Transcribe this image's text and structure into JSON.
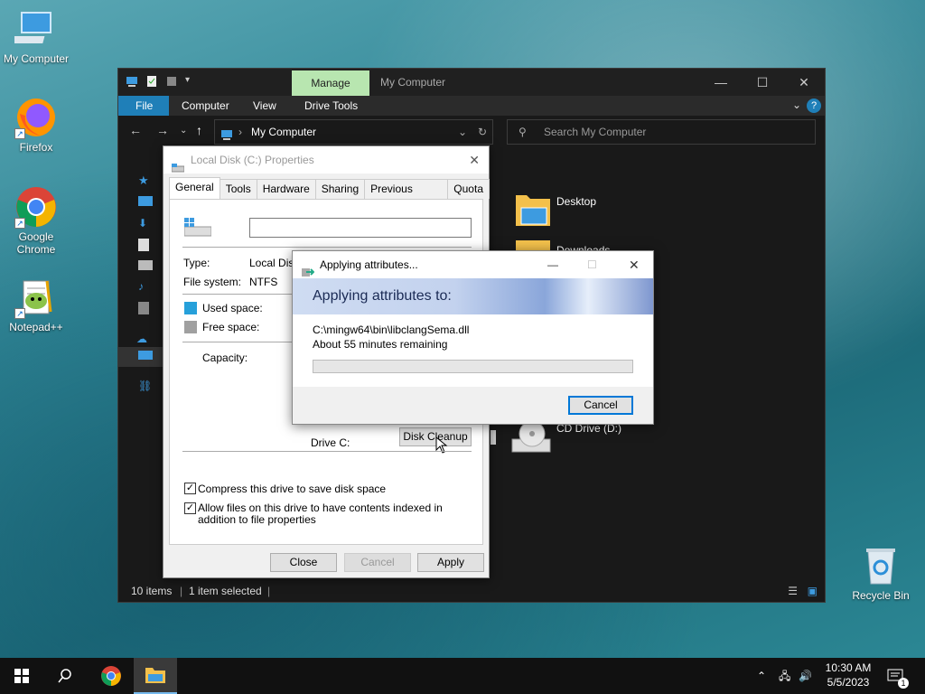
{
  "desktop": {
    "icons": [
      {
        "label": "My Computer"
      },
      {
        "label": "Firefox"
      },
      {
        "label": "Google Chrome"
      },
      {
        "label": "Notepad++"
      },
      {
        "label": "Recycle Bin"
      }
    ]
  },
  "explorer": {
    "manage_tab": "Manage",
    "title": "My Computer",
    "ribbon_tabs": [
      "File",
      "Computer",
      "View",
      "Drive Tools"
    ],
    "address": "My Computer",
    "search_placeholder": "Search My Computer",
    "items": {
      "desktop": "Desktop",
      "downloads": "Downloads",
      "cd_drive": "CD Drive (D:)"
    },
    "status": {
      "count": "10 items",
      "selected": "1 item selected"
    }
  },
  "properties": {
    "title": "Local Disk (C:) Properties",
    "tabs": [
      "General",
      "Tools",
      "Hardware",
      "Sharing",
      "Previous Versions",
      "Quota"
    ],
    "name_value": "",
    "type_label": "Type:",
    "type_value": "Local Disk",
    "fs_label": "File system:",
    "fs_value": "NTFS",
    "used_label": "Used space:",
    "free_label": "Free space:",
    "capacity_label": "Capacity:",
    "drive_label": "Drive C:",
    "disk_cleanup": "Disk Cleanup",
    "compress_label": "Compress this drive to save disk space",
    "index_label": "Allow files on this drive to have contents indexed in addition to file properties",
    "buttons": {
      "close": "Close",
      "cancel": "Cancel",
      "apply": "Apply"
    }
  },
  "progress": {
    "title": "Applying attributes...",
    "heading": "Applying attributes to:",
    "file": "C:\\mingw64\\bin\\libclangSema.dll",
    "remaining": "About 55 minutes remaining",
    "percent": 0,
    "cancel": "Cancel"
  },
  "taskbar": {
    "time": "10:30 AM",
    "date": "5/5/2023",
    "notification_count": "1"
  },
  "colors": {
    "file_tab": "#1f7fb8",
    "manage_tab": "#b8e6b0",
    "used_space": "#26a0da",
    "free_space": "#a0a0a0"
  }
}
